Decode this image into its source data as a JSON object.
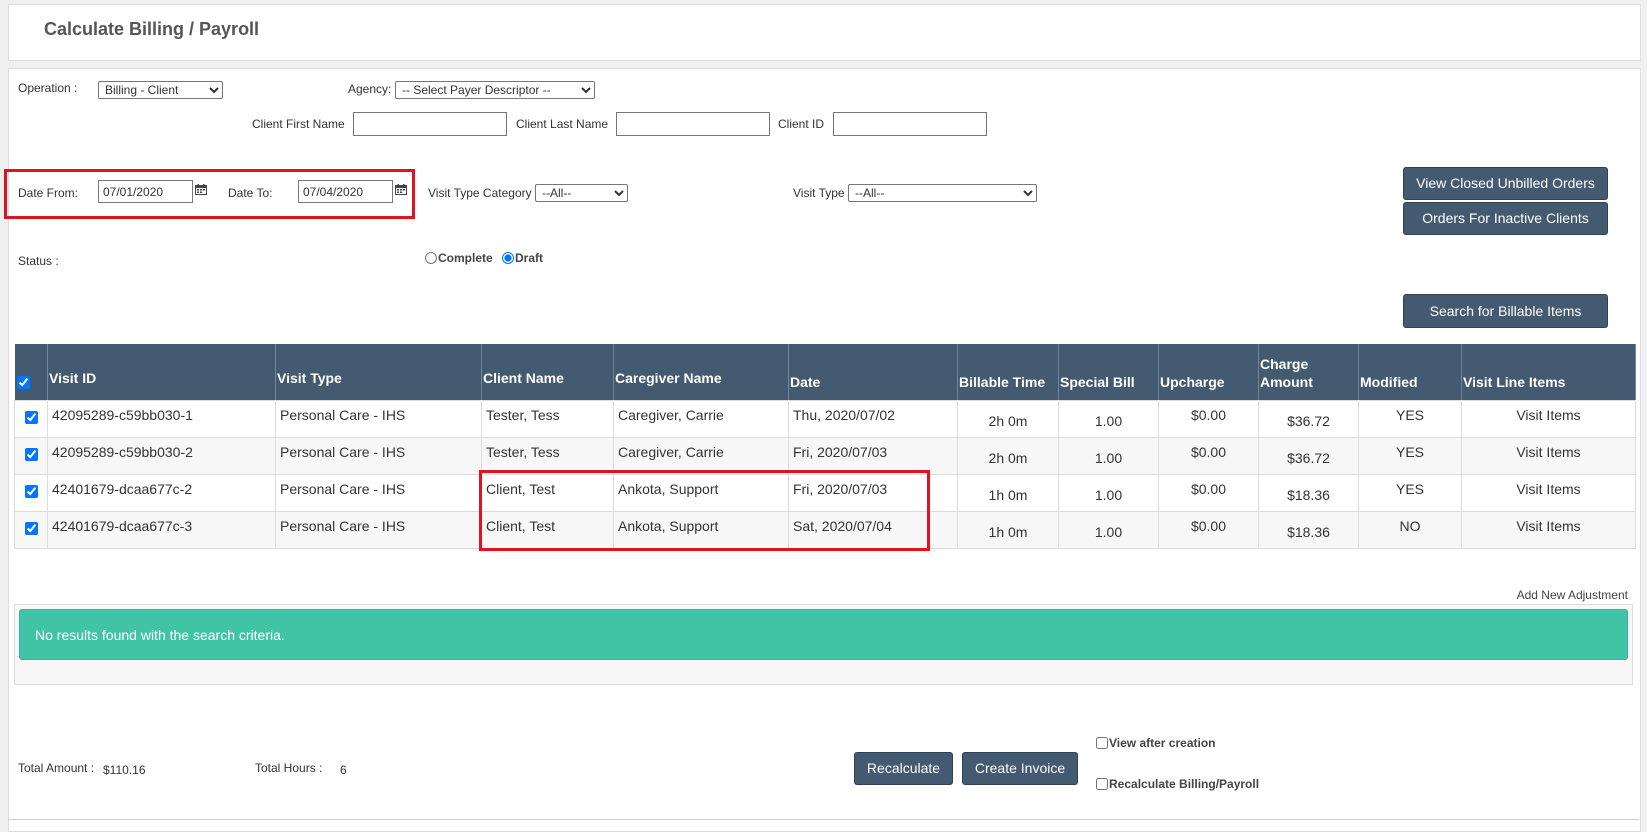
{
  "page": {
    "title": "Calculate Billing / Payroll"
  },
  "filters": {
    "operation_label": "Operation :",
    "operation_value": "Billing - Client",
    "agency_label": "Agency:",
    "agency_value": "-- Select Payer Descriptor --",
    "first_name_label": "Client First Name",
    "last_name_label": "Client Last Name",
    "client_id_label": "Client ID",
    "date_from_label": "Date From:",
    "date_from_value": "07/01/2020",
    "date_to_label": "Date To:",
    "date_to_value": "07/04/2020",
    "visit_type_category_label": "Visit Type Category",
    "visit_type_category_value": "--All--",
    "visit_type_label": "Visit Type",
    "visit_type_value": "--All--",
    "status_label": "Status :",
    "status_complete": "Complete",
    "status_draft": "Draft"
  },
  "buttons": {
    "view_closed": "View Closed Unbilled Orders",
    "inactive_clients": "Orders For Inactive Clients",
    "search": "Search for Billable Items",
    "recalculate": "Recalculate",
    "create_invoice": "Create Invoice"
  },
  "table": {
    "headers": [
      "Visit ID",
      "Visit Type",
      "Client Name",
      "Caregiver Name",
      "Date",
      "Billable Time",
      "Special Bill",
      "Upcharge",
      "Charge Amount",
      "Modified",
      "Visit Line Items"
    ],
    "rows": [
      {
        "visit_id": "42095289-c59bb030-1",
        "visit_type": "Personal Care - IHS",
        "client": "Tester, Tess",
        "caregiver": "Caregiver, Carrie",
        "date": "Thu, 2020/07/02",
        "billable_time": "2h 0m",
        "special_bill": "1.00",
        "upcharge": "$0.00",
        "charge": "$36.72",
        "modified": "YES",
        "line_items": "Visit Items"
      },
      {
        "visit_id": "42095289-c59bb030-2",
        "visit_type": "Personal Care - IHS",
        "client": "Tester, Tess",
        "caregiver": "Caregiver, Carrie",
        "date": "Fri, 2020/07/03",
        "billable_time": "2h 0m",
        "special_bill": "1.00",
        "upcharge": "$0.00",
        "charge": "$36.72",
        "modified": "YES",
        "line_items": "Visit Items"
      },
      {
        "visit_id": "42401679-dcaa677c-2",
        "visit_type": "Personal Care - IHS",
        "client": "Client, Test",
        "caregiver": "Ankota, Support",
        "date": "Fri, 2020/07/03",
        "billable_time": "1h 0m",
        "special_bill": "1.00",
        "upcharge": "$0.00",
        "charge": "$18.36",
        "modified": "YES",
        "line_items": "Visit Items"
      },
      {
        "visit_id": "42401679-dcaa677c-3",
        "visit_type": "Personal Care - IHS",
        "client": "Client, Test",
        "caregiver": "Ankota, Support",
        "date": "Sat, 2020/07/04",
        "billable_time": "1h 0m",
        "special_bill": "1.00",
        "upcharge": "$0.00",
        "charge": "$18.36",
        "modified": "NO",
        "line_items": "Visit Items"
      }
    ]
  },
  "adjustment": {
    "add_link": "Add New Adjustment",
    "no_results": "No results found with the search criteria."
  },
  "totals": {
    "amount_label": "Total Amount :",
    "amount_value": "$110.16",
    "hours_label": "Total Hours :",
    "hours_value": "6"
  },
  "options": {
    "view_after_creation": "View after creation",
    "recalculate_billing": "Recalculate Billing/Payroll"
  },
  "colors": {
    "header_bg": "#435a70",
    "button_bg": "#435a70",
    "success_bg": "#41c4a6",
    "highlight": "#e0141e"
  }
}
